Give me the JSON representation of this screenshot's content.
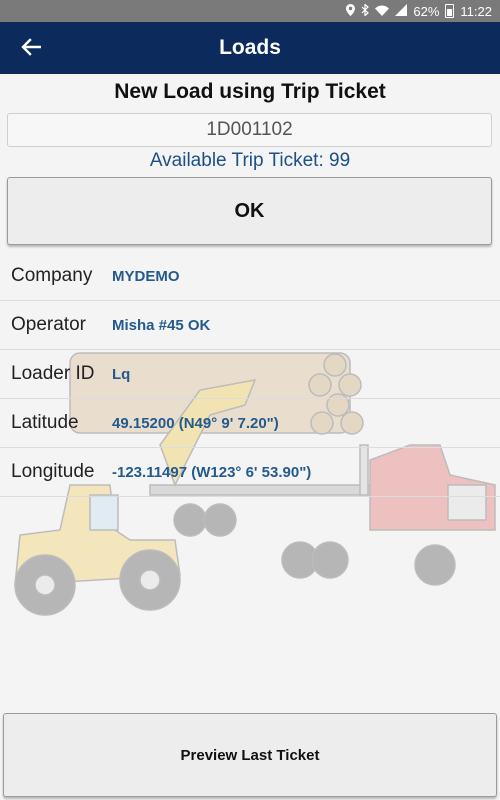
{
  "status_bar": {
    "battery": "62%",
    "time": "11:22",
    "icons": [
      "location-icon",
      "bluetooth-icon",
      "wifi-icon",
      "signal-icon",
      "battery-icon"
    ]
  },
  "app_bar": {
    "title": "Loads",
    "back_icon": "back-arrow-icon",
    "background_color": "#0c2a5b"
  },
  "form": {
    "heading": "New Load using Trip Ticket",
    "ticket_value": "1D001102",
    "available_text": "Available Trip Ticket: 99",
    "ok_label": "OK"
  },
  "details": [
    {
      "label": "Company",
      "value": "MYDEMO"
    },
    {
      "label": "Operator",
      "value": "Misha #45 OK"
    },
    {
      "label": "Loader ID",
      "value": "Lq"
    },
    {
      "label": "Latitude",
      "value": "49.15200 (N49° 9' 7.20\")"
    },
    {
      "label": "Longitude",
      "value": "-123.11497 (W123° 6' 53.90\")"
    }
  ],
  "footer": {
    "preview_label": "Preview Last Ticket"
  },
  "colors": {
    "accent": "#0c2a5b",
    "value_text": "#245a8c",
    "truck_cab": "#d93a3a",
    "loader": "#f2c531"
  }
}
